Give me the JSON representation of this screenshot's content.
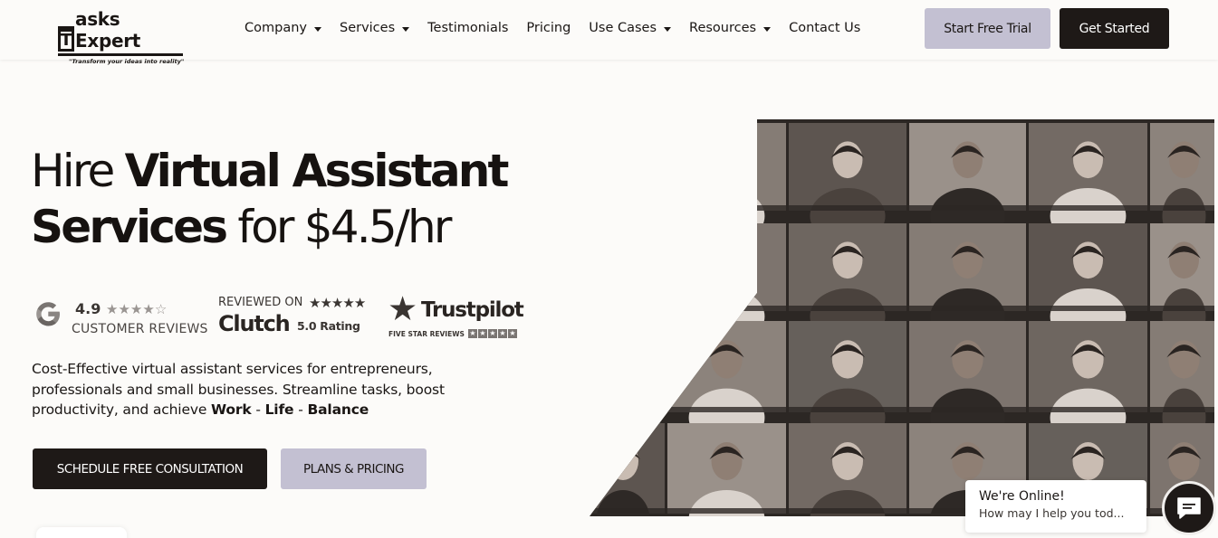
{
  "header": {
    "logo_name": "Tasks Expert",
    "logo_box_letter": "T",
    "logo_rest": "asks Expert",
    "logo_tagline": "\"Transform your ideas into reality\"",
    "nav": [
      {
        "label": "Company",
        "dropdown": true
      },
      {
        "label": "Services",
        "dropdown": true
      },
      {
        "label": "Testimonials",
        "dropdown": false
      },
      {
        "label": "Pricing",
        "dropdown": false
      },
      {
        "label": "Use Cases",
        "dropdown": true
      },
      {
        "label": "Resources",
        "dropdown": true
      },
      {
        "label": "Contact Us",
        "dropdown": false
      }
    ],
    "trial_label": "Start Free Trial",
    "started_label": "Get Started"
  },
  "hero": {
    "title_w1": "Hire ",
    "title_w2": "Virtual Assistant",
    "title_w3": "Services",
    "title_w4": " for $4.5/hr"
  },
  "reviews": {
    "google": {
      "rating": "4.9",
      "label": "CUSTOMER REVIEWS",
      "stars": 4.5
    },
    "clutch": {
      "reviewed_on": "REVIEWED ON",
      "name": "Clutch",
      "rating": "5.0 Rating",
      "stars": 5
    },
    "trustpilot": {
      "name": "Trustpilot",
      "sub": "FIVE STAR REVIEWS",
      "stars": 5
    }
  },
  "description": {
    "text": "Cost-Effective virtual assistant services for entrepreneurs, professionals and small businesses. Streamline tasks, boost productivity, and achieve ",
    "work": "Work",
    "dash1": " - ",
    "life": "Life",
    "dash2": " - ",
    "balance": "Balance"
  },
  "cta": {
    "consult_label": "SCHEDULE FREE CONSULTATION",
    "plans_label": "PLANS & PRICING"
  },
  "chat": {
    "title": "We're Online!",
    "subtitle": "How may I help you tod..."
  },
  "colors": {
    "dark": "#1e1917",
    "lavender": "#c3c0d2",
    "background": "#fcfbf9"
  }
}
